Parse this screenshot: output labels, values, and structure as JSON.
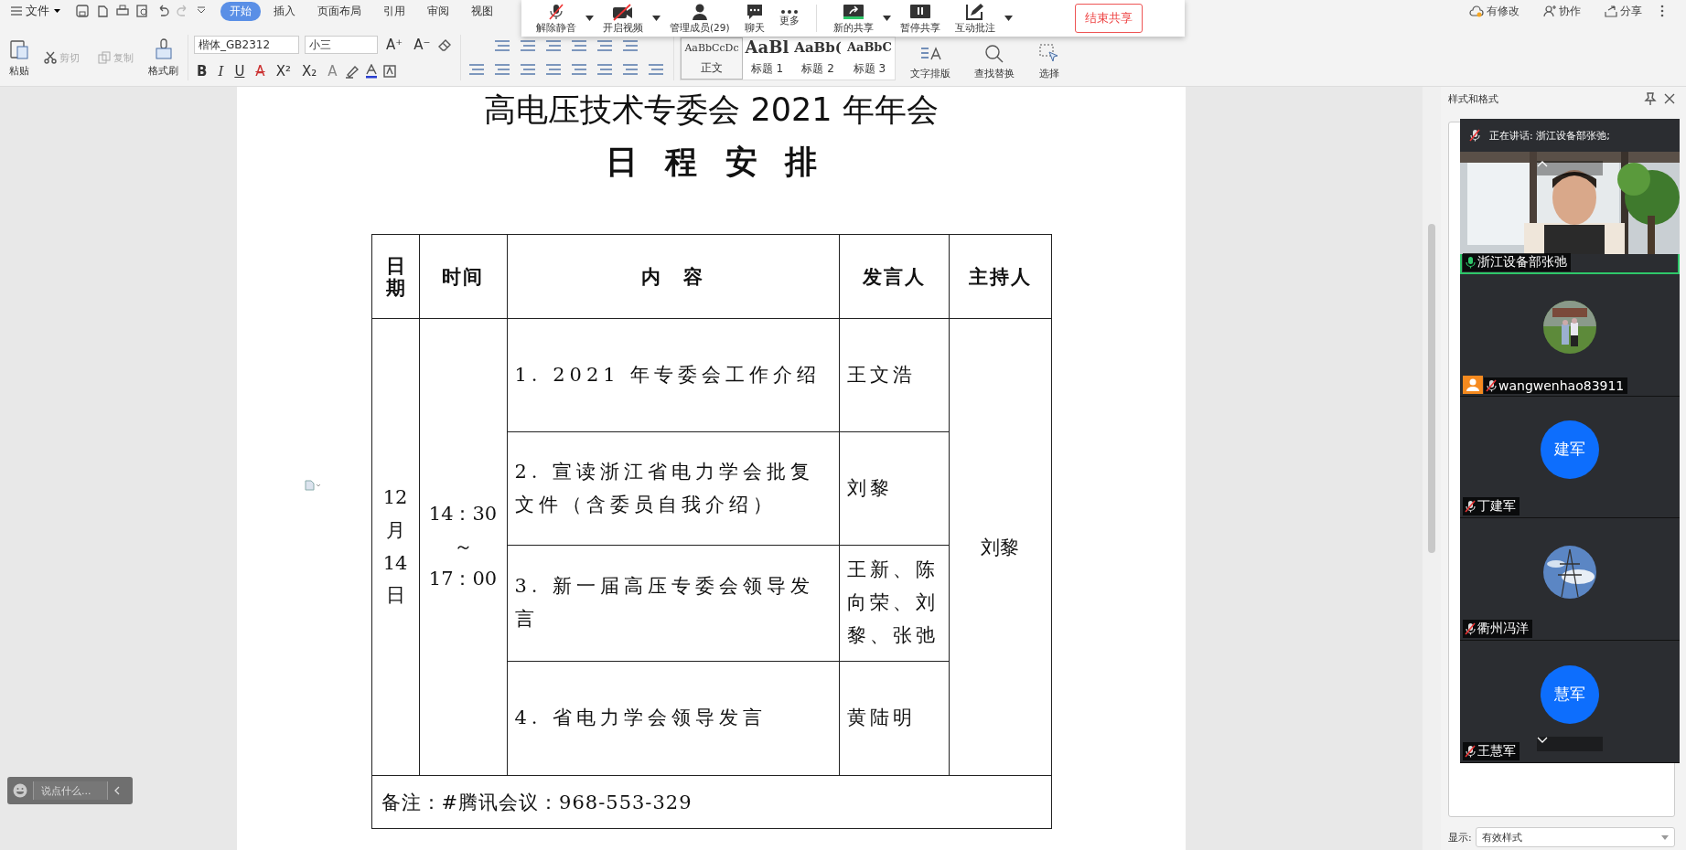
{
  "menu": {
    "label": "文件"
  },
  "tabs": [
    {
      "label": "开始",
      "selected": true
    },
    {
      "label": "插入",
      "selected": false
    },
    {
      "label": "页面布局",
      "selected": false
    },
    {
      "label": "引用",
      "selected": false
    },
    {
      "label": "审阅",
      "selected": false
    },
    {
      "label": "视图",
      "selected": false
    }
  ],
  "header_actions": [
    "有修改",
    "协作",
    "分享"
  ],
  "clipboard": [
    {
      "label": "粘贴",
      "disabled": false,
      "kind": "paste"
    },
    {
      "label": "剪切",
      "disabled": true,
      "kind": "cut"
    },
    {
      "label": "复制",
      "disabled": true,
      "kind": "copy"
    },
    {
      "label": "格式刷",
      "disabled": false,
      "kind": "brush"
    }
  ],
  "font": {
    "family": "楷体_GB2312",
    "size": "小三"
  },
  "font_size_buttons": [
    "A⁺",
    "A⁻"
  ],
  "format_buttons": [
    {
      "label": "B",
      "kind": "bold"
    },
    {
      "label": "I",
      "kind": "italic"
    },
    {
      "label": "U",
      "kind": "underline"
    },
    {
      "label": "A",
      "kind": "strike"
    },
    {
      "label": "X²",
      "kind": "sup"
    },
    {
      "label": "X₂",
      "kind": "sub"
    },
    {
      "label": "A",
      "kind": "faded"
    }
  ],
  "styles": [
    {
      "preview": "AaBbCcDc",
      "label": "正文",
      "selected": true,
      "kind": "body"
    },
    {
      "preview": "AaBl",
      "label": "标题 1",
      "selected": false,
      "kind": "h1"
    },
    {
      "preview": "AaBb(",
      "label": "标题 2",
      "selected": false,
      "kind": "h2"
    },
    {
      "preview": "AaBbC",
      "label": "标题 3",
      "selected": false,
      "kind": "h3"
    }
  ],
  "tools": [
    {
      "label": "文字排版",
      "kind": "layout"
    },
    {
      "label": "查找替换",
      "kind": "find"
    },
    {
      "label": "选择",
      "kind": "select"
    }
  ],
  "meeting_toolbar": {
    "buttons": [
      {
        "label": "解除静音",
        "kind": "mic"
      },
      {
        "label": "开启视频",
        "kind": "camera"
      },
      {
        "label": "管理成员(29)",
        "kind": "members"
      },
      {
        "label": "聊天",
        "kind": "chat"
      },
      {
        "label": "更多",
        "kind": "more"
      },
      {
        "label": "新的共享",
        "kind": "share"
      },
      {
        "label": "暂停共享",
        "kind": "pause"
      },
      {
        "label": "互动批注",
        "kind": "annotate"
      }
    ],
    "end_button": "结束共享"
  },
  "document": {
    "title": "高电压技术专委会 2021 年年会",
    "subtitle": "日 程 安 排",
    "table": {
      "headers": [
        "日期",
        "时间",
        "内　容",
        "发言人",
        "主持人"
      ],
      "date": "12月14日",
      "time_lines": [
        "14：30",
        "～",
        "17：00"
      ],
      "host": "刘黎",
      "rows": [
        {
          "content": "1. 2021 年专委会工作介绍",
          "speaker": "王文浩"
        },
        {
          "content": "2. 宣读浙江省电力学会批复文件（含委员自我介绍）",
          "speaker": "刘黎"
        },
        {
          "content": "3.  新一届高压专委会领导发言",
          "speaker": "王新、陈向荣、刘黎、张弛"
        },
        {
          "content": "4.  省电力学会领导发言",
          "speaker": "黄陆明"
        }
      ],
      "note": "备注：#腾讯会议：968-553-329"
    }
  },
  "styles_pane": {
    "title": "样式和格式",
    "show_label": "显示:",
    "show_value": "有效样式"
  },
  "video_panel": {
    "speaking": "正在讲话: 浙江设备部张弛;",
    "participants": [
      {
        "name": "浙江设备部张弛",
        "kind": "video",
        "muted": false,
        "selected": true,
        "badge": false
      },
      {
        "name": "wangwenhao83911",
        "muted": true,
        "selected": false,
        "badge": true
      },
      {
        "name": "丁建军",
        "kind": "initials",
        "initials": "建军",
        "muted": true,
        "selected": false,
        "badge": false
      },
      {
        "name": "衢州冯洋",
        "kind": "photo2",
        "muted": true,
        "selected": false,
        "badge": false
      },
      {
        "name": "王慧军",
        "kind": "initials",
        "initials": "慧军",
        "muted": true,
        "selected": false,
        "badge": false
      }
    ]
  },
  "chat_input": {
    "placeholder": "说点什么..."
  }
}
